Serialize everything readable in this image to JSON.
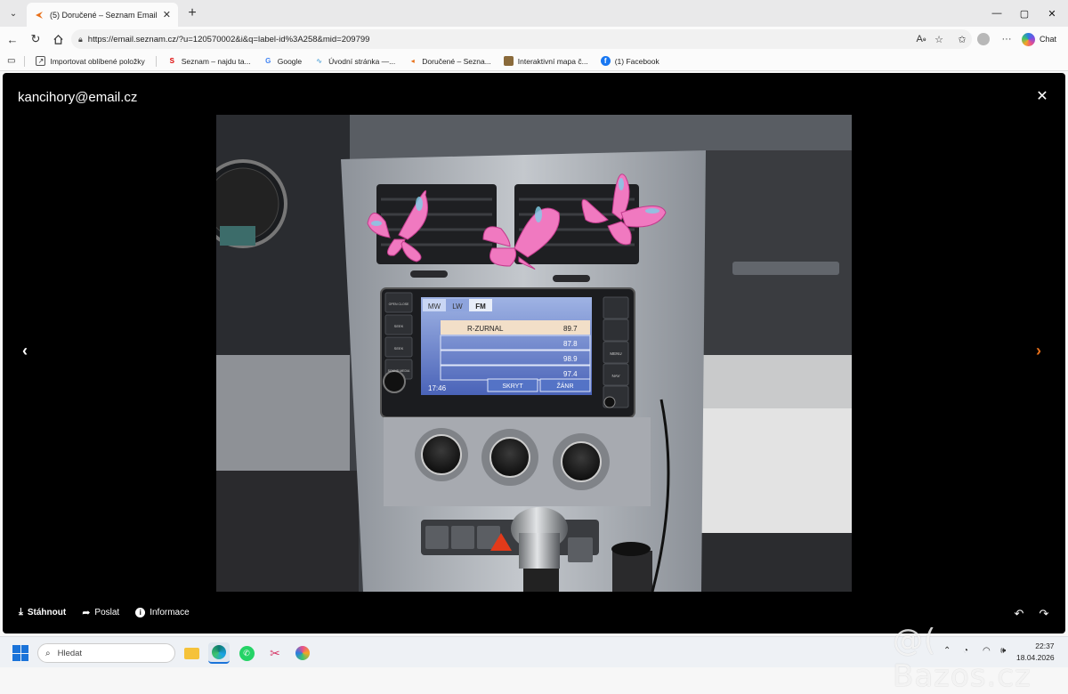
{
  "browser": {
    "tab": {
      "title": "(5) Doručené – Seznam Email"
    },
    "url": "https://email.seznam.cz/?u=120570002&i&q=label-id%3A258&mid=209799",
    "chat_label": "Chat",
    "window_controls": {
      "minimize": "—",
      "maximize": "▢",
      "close": "✕"
    }
  },
  "bookmarks": [
    {
      "label": "Importovat oblíbené položky",
      "icon": "import-icon"
    },
    {
      "label": "Seznam – najdu ta...",
      "icon": "seznam-icon"
    },
    {
      "label": "Google",
      "icon": "google-icon"
    },
    {
      "label": "Úvodní stránka —...",
      "icon": "home-page-icon"
    },
    {
      "label": "Doručené – Sezna...",
      "icon": "seznam-mail-icon"
    },
    {
      "label": "Interaktivní mapa č...",
      "icon": "map-icon"
    },
    {
      "label": "(1) Facebook",
      "icon": "facebook-icon"
    }
  ],
  "viewer": {
    "sender": "kancihory@email.cz",
    "actions": {
      "download": "Stáhnout",
      "send": "Poslat",
      "info": "Informace"
    }
  },
  "radio": {
    "bands": [
      "MW",
      "LW",
      "FM"
    ],
    "active_band": "FM",
    "station_name": "R-ZURNAL",
    "stations": [
      {
        "freq": "89.7"
      },
      {
        "freq": "87.8"
      },
      {
        "freq": "98.9"
      },
      {
        "freq": "97.4"
      }
    ],
    "time": "17:46",
    "skryt": "SKRYT",
    "zanr": "ŽÁNR",
    "left_buttons": [
      "OPEN CLOSE",
      "SEEK",
      "SEEK",
      "SOUND MEDIA"
    ],
    "right_buttons": [
      "",
      "",
      "MENU",
      "NAV"
    ]
  },
  "taskbar": {
    "search_placeholder": "Hledat",
    "time": "22:37",
    "date": "18.04.2026"
  },
  "watermark": "@( Bazos.cz",
  "colors": {
    "accent": "#e8701a",
    "windows_blue": "#1a73d9"
  }
}
